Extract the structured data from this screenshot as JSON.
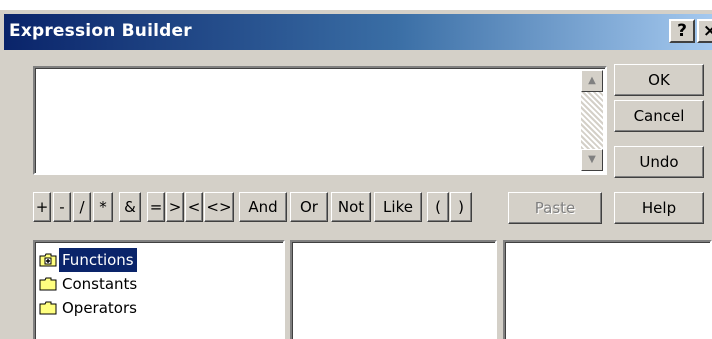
{
  "window": {
    "title": "Expression Builder",
    "help_button": "?",
    "close_button": "×"
  },
  "side_buttons": {
    "ok": "OK",
    "cancel": "Cancel",
    "undo": "Undo",
    "help": "Help"
  },
  "operators": [
    "+",
    "-",
    "/",
    "*",
    "&",
    "=",
    ">",
    "<",
    "<>",
    "And",
    "Or",
    "Not",
    "Like",
    "(",
    ")"
  ],
  "paste_label": "Paste",
  "tree": {
    "items": [
      {
        "label": "Functions",
        "icon": "folder-plus-icon",
        "selected": true
      },
      {
        "label": "Constants",
        "icon": "folder-icon",
        "selected": false
      },
      {
        "label": "Operators",
        "icon": "folder-icon",
        "selected": false
      }
    ]
  },
  "colors": {
    "title_start": "#0a246a",
    "title_end": "#a6caf0",
    "dialog_bg": "#d4d0c8",
    "selection": "#0a246a"
  }
}
